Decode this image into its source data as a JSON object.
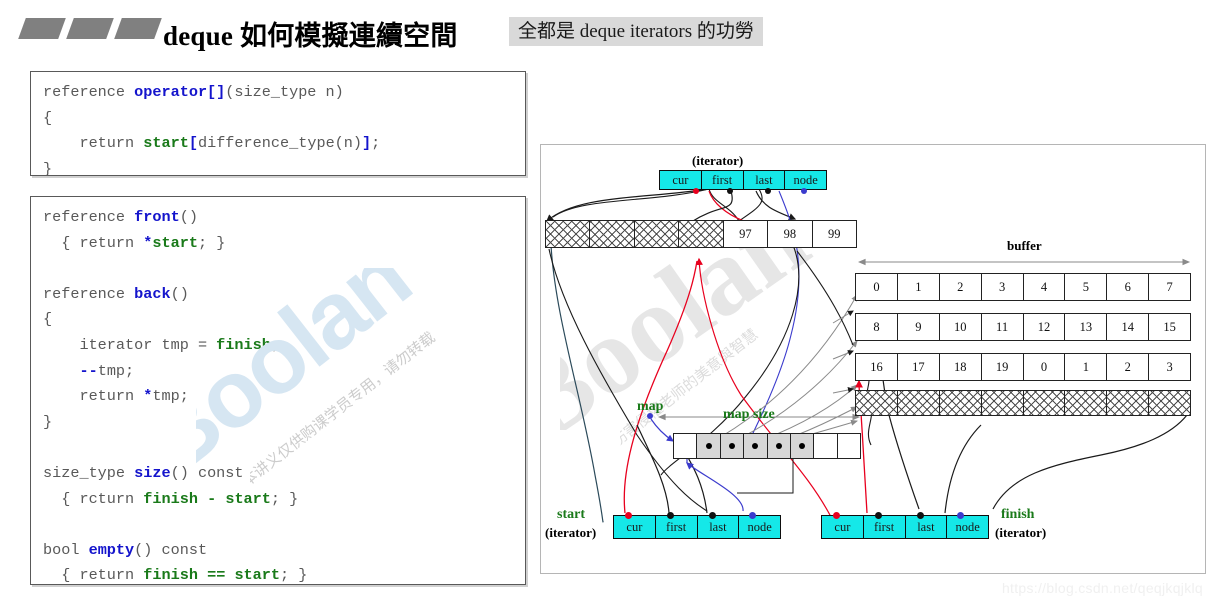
{
  "header": {
    "title": "deque 如何模擬連續空間",
    "subtitle_badge": "全都是 deque iterators 的功勞",
    "bullet_count": 3
  },
  "code_blocks": [
    {
      "id": "operator-index",
      "lines": [
        "reference operator[](size_type n)",
        "{",
        "    return start[difference_type(n)];",
        "}"
      ]
    },
    {
      "id": "front-back-size-empty",
      "lines": [
        "reference front()",
        "  { return *start; }",
        "",
        "reference back()",
        "{",
        "    iterator tmp = finish;",
        "    --tmp;",
        "    return *tmp;",
        "}",
        "",
        "size_type size() const",
        "  { rcturn finish - start; }",
        "",
        "bool empty() const",
        "  { return finish == start; }"
      ]
    }
  ],
  "diagram": {
    "top_iterator": {
      "caption": "(iterator)",
      "fields": [
        "cur",
        "first",
        "last",
        "node"
      ]
    },
    "top_buffer": {
      "hatched_cells": 4,
      "values": [
        "97",
        "98",
        "99"
      ]
    },
    "buffer_label": "buffer",
    "buffer_rows": [
      [
        "0",
        "1",
        "2",
        "3",
        "4",
        "5",
        "6",
        "7"
      ],
      [
        "8",
        "9",
        "10",
        "11",
        "12",
        "13",
        "14",
        "15"
      ],
      [
        "16",
        "17",
        "18",
        "19",
        "0",
        "1",
        "2",
        "3"
      ]
    ],
    "buffer_hatched_row_cells": 8,
    "map_label": "map",
    "map_size_label": "map size",
    "map_cells": [
      {
        "filled": false
      },
      {
        "filled": true
      },
      {
        "filled": true
      },
      {
        "filled": true
      },
      {
        "filled": true
      },
      {
        "filled": true
      },
      {
        "filled": false
      },
      {
        "filled": false
      }
    ],
    "start_iterator": {
      "name": "start",
      "caption": "(iterator)",
      "fields": [
        "cur",
        "first",
        "last",
        "node"
      ]
    },
    "finish_iterator": {
      "name": "finish",
      "caption": "(iterator)",
      "fields": [
        "cur",
        "first",
        "last",
        "node"
      ]
    },
    "colors": {
      "iterator_fill": "#15e8e8",
      "label_green": "#1a7a1a",
      "pointer_red": "#e8001e",
      "pointer_blue": "#3b3bcd",
      "pointer_black": "#1a1a1a",
      "map_cell_fill": "#d7d7d7"
    }
  },
  "watermarks": {
    "brand": "Boolan",
    "brand_small": "Boolan",
    "notice": "本讲义仅供购课学员专用，请勿转载",
    "notice2": "伤害侵權老师的美意與智慧",
    "csdn": "https://blog.csdn.net/qeqjkqjklq"
  }
}
